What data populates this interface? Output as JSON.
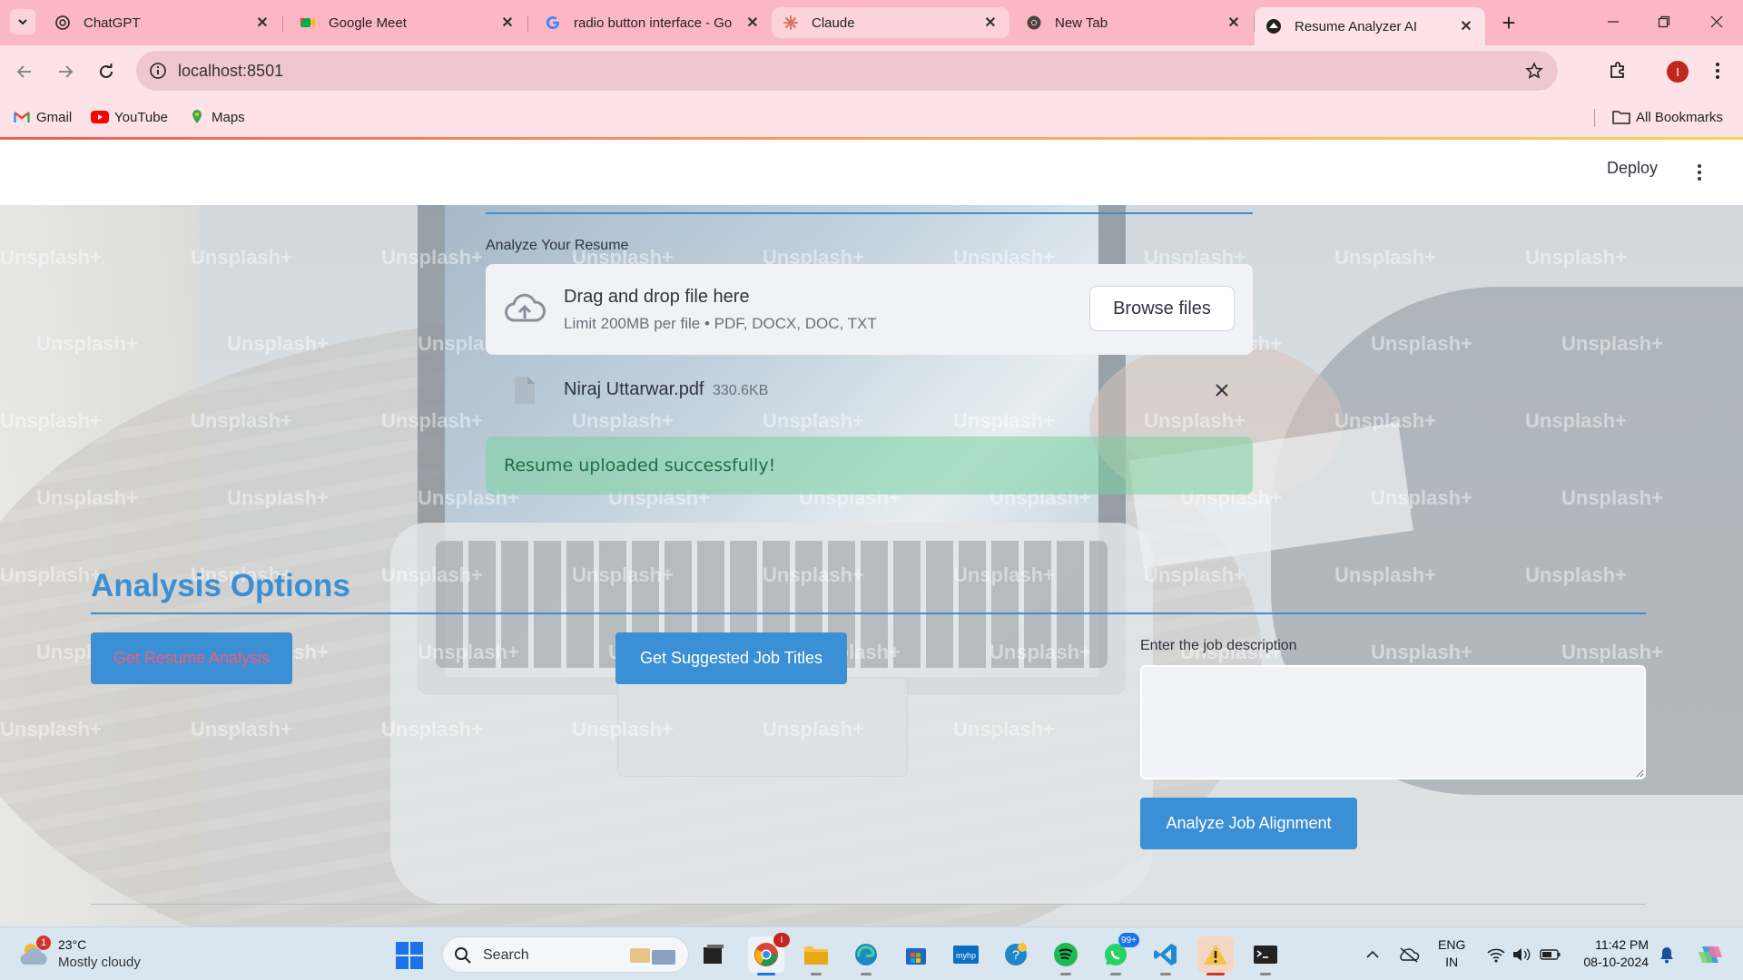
{
  "browser": {
    "tabs": [
      {
        "title": "ChatGPT",
        "icon": "chatgpt-icon"
      },
      {
        "title": "Google Meet",
        "icon": "google-meet-icon"
      },
      {
        "title": "radio button interface - Go",
        "icon": "google-icon"
      },
      {
        "title": "Claude",
        "icon": "claude-icon"
      },
      {
        "title": "New Tab",
        "icon": "chrome-icon"
      },
      {
        "title": "Resume Analyzer AI",
        "icon": "streamlit-icon",
        "active": true
      }
    ],
    "url": "localhost:8501",
    "profile_initial": "I",
    "bookmarks": [
      {
        "label": "Gmail",
        "icon": "gmail-icon"
      },
      {
        "label": "YouTube",
        "icon": "youtube-icon"
      },
      {
        "label": "Maps",
        "icon": "maps-icon"
      }
    ],
    "all_bookmarks_label": "All Bookmarks"
  },
  "app_header": {
    "deploy_label": "Deploy"
  },
  "upload": {
    "label": "Analyze Your Resume",
    "drop_title": "Drag and drop file here",
    "drop_limit": "Limit 200MB per file • PDF, DOCX, DOC, TXT",
    "browse_label": "Browse files",
    "file_name": "Niraj Uttarwar.pdf",
    "file_size": "330.6KB",
    "success_message": "Resume uploaded successfully!"
  },
  "analysis": {
    "title": "Analysis Options",
    "resume_analysis_label": "Get Resume Analysis",
    "job_titles_label": "Get Suggested Job Titles",
    "job_description_label": "Enter the job description",
    "job_description_value": "",
    "analyze_alignment_label": "Analyze Job Alignment"
  },
  "watermark": "Unsplash+",
  "colors": {
    "accent": "#3b8fd4",
    "success_bg": "#7ad2a0",
    "success_text": "#1f6e45",
    "tab_strip": "#fbb8c4",
    "toolbar": "#fde2e7"
  },
  "taskbar": {
    "weather_badge": "1",
    "temperature": "23°C",
    "condition": "Mostly cloudy",
    "search_placeholder": "Search",
    "whatsapp_badge": "99+",
    "language": "ENG",
    "region": "IN",
    "time": "11:42 PM",
    "date": "08-10-2024"
  }
}
